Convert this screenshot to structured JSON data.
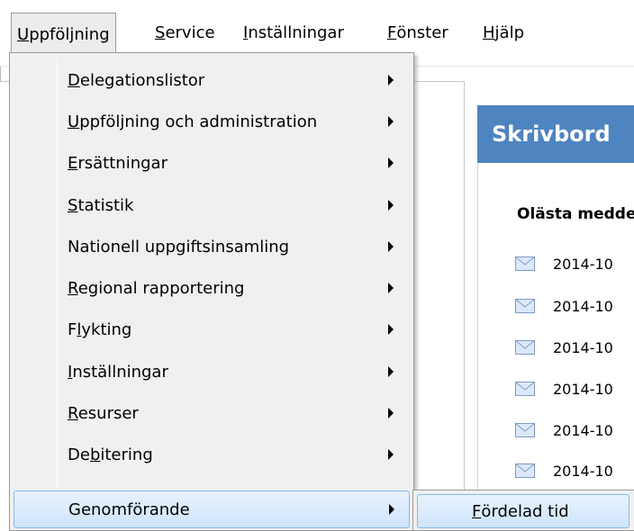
{
  "menubar": {
    "items": [
      {
        "mnemonic": "U",
        "rest": "ppföljning"
      },
      {
        "mnemonic": "S",
        "rest": "ervice"
      },
      {
        "mnemonic": "I",
        "rest": "nställningar"
      },
      {
        "mnemonic": "F",
        "rest": "önster"
      },
      {
        "mnemonic": "H",
        "rest": "jälp"
      }
    ]
  },
  "dropdown": {
    "items": [
      {
        "pre": "",
        "mnemonic": "D",
        "rest": "elegationslistor"
      },
      {
        "pre": "",
        "mnemonic": "U",
        "rest": "ppföljning och administration"
      },
      {
        "pre": "",
        "mnemonic": "E",
        "rest": "rsättningar"
      },
      {
        "pre": "",
        "mnemonic": "S",
        "rest": "tatistik"
      },
      {
        "pre": "",
        "mnemonic": "",
        "rest": "Nationell uppgiftsinsamling"
      },
      {
        "pre": "",
        "mnemonic": "R",
        "rest": "egional rapportering"
      },
      {
        "pre": "F",
        "mnemonic": "l",
        "rest": "ykting"
      },
      {
        "pre": "",
        "mnemonic": "I",
        "rest": "nställningar"
      },
      {
        "pre": "",
        "mnemonic": "R",
        "rest": "esurser"
      },
      {
        "pre": "De",
        "mnemonic": "b",
        "rest": "itering"
      },
      {
        "pre": "",
        "mnemonic": "",
        "rest": "Genomförande"
      }
    ]
  },
  "submenu": {
    "item": {
      "mnemonic": "F",
      "rest": "ördelad tid"
    }
  },
  "desk": {
    "title": "Skrivbord",
    "unread_title": "Olästa meddelanden",
    "messages": [
      "2014-10",
      "2014-10",
      "2014-10",
      "2014-10",
      "2014-10",
      "2014-10"
    ]
  },
  "colors": {
    "header_blue": "#4e84c0",
    "highlight_border": "#86b9ee",
    "menu_bg": "#f0f0f0"
  }
}
